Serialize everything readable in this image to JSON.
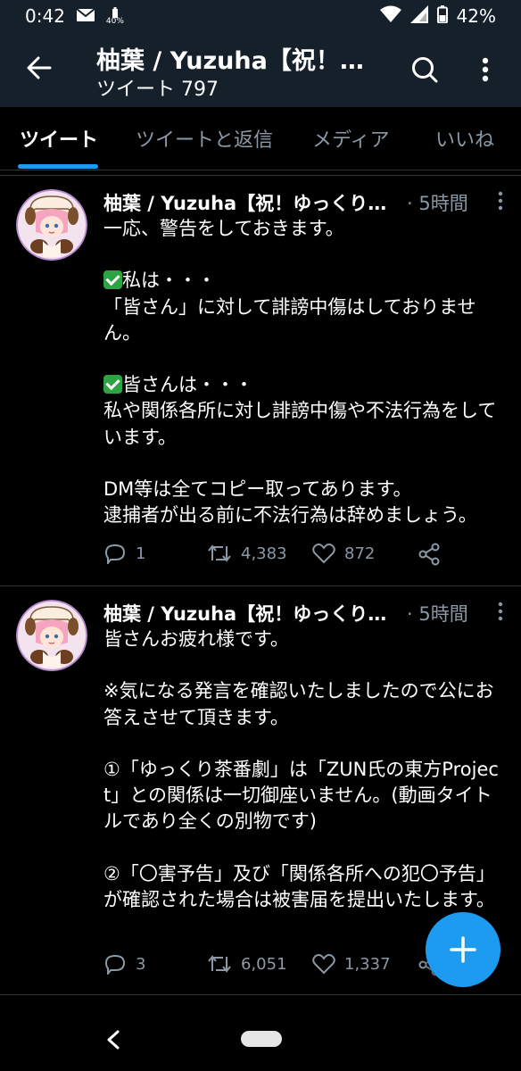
{
  "statusbar": {
    "time": "0:42",
    "battery_small": "40%",
    "battery_percent": "42%"
  },
  "header": {
    "title": "柚葉 / Yuzuha【祝！…",
    "subtitle": "ツイート 797"
  },
  "tabs": [
    {
      "label": "ツイート"
    },
    {
      "label": "ツイートと返信"
    },
    {
      "label": "メディア"
    },
    {
      "label": "いいね"
    }
  ],
  "tweets": [
    {
      "name": "柚葉 / Yuzuha【祝！ゆっくり茶…",
      "time": "· 5時間",
      "p1": "一応、警告をしておきます。",
      "p2": "私は・・・",
      "p3": "「皆さん」に対して誹謗中傷はしておりません。",
      "p4": "皆さんは・・・",
      "p5": "私や関係各所に対し誹謗中傷や不法行為をしています。",
      "p6": "DM等は全てコピー取ってあります。\n逮捕者が出る前に不法行為は辞めましょう。",
      "replies": "1",
      "retweets": "4,383",
      "likes": "872"
    },
    {
      "name": "柚葉 / Yuzuha【祝！ゆっくり茶…",
      "time": "· 5時間",
      "body": "皆さんお疲れ様です。\n\n※気になる発言を確認いたしましたので公にお答えさせて頂きます。\n\n①「ゆっくり茶番劇」は「ZUN氏の東方Project」との関係は一切御座いません。(動画タイトルであり全くの別物です)\n\n②「〇害予告」及び「関係各所への犯〇予告」が確認された場合は被害届を提出いたします。",
      "replies": "3",
      "retweets": "6,051",
      "likes": "1,337"
    }
  ],
  "colors": {
    "header_bg": "#15202b",
    "accent": "#1d9bf0",
    "muted": "#8b98a5",
    "check": "#2da343"
  }
}
